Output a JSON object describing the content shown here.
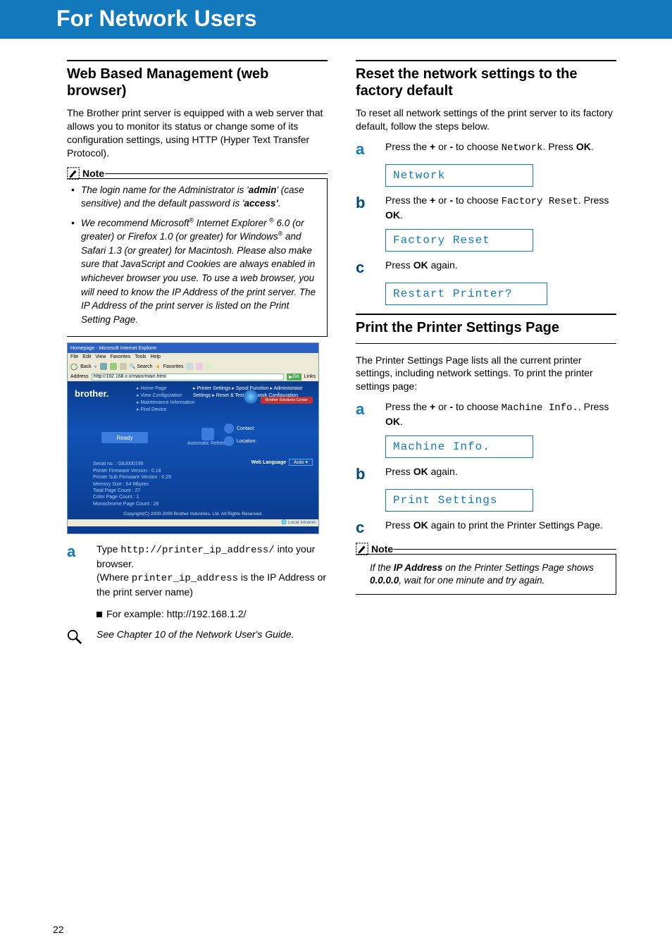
{
  "header": "For Network Users",
  "page_number": "22",
  "left": {
    "heading": "Web Based Management (web browser)",
    "intro": "The Brother print server is equipped with a web server that allows you to monitor its status or change some of its configuration settings, using HTTP (Hyper Text Transfer Protocol).",
    "note_label": "Note",
    "note_bullets": {
      "b1_pre": "The login name for the Administrator is '",
      "b1_admin": "admin",
      "b1_mid": "' (case sensitive) and the default password is '",
      "b1_access": "access'",
      "b1_end": ".",
      "b2_pre": "We recommend Microsoft",
      "b2_r1": "®",
      "b2_ie": " Internet Explorer ",
      "b2_r2": "®",
      "b2_mid1": " 6.0 (or greater) or Firefox 1.0 (or greater) for Windows",
      "b2_r3": "®",
      "b2_mid2": " and Safari 1.3 (or greater) for Macintosh. Please also make sure that JavaScript and Cookies are always enabled in whichever browser you use. To use a web browser, you will need to know the IP Address of the print server. The IP Address of the print server is listed on the Print Setting Page."
    },
    "screenshot": {
      "title": "Homepage - Microsoft Internet Explorer",
      "menu": [
        "File",
        "Edit",
        "View",
        "Favorites",
        "Tools",
        "Help"
      ],
      "back": "Back",
      "search": "Search",
      "favorites": "Favorites",
      "addr_label": "Address",
      "addr": "http://192.168.x.x/main/main.html",
      "go": "Go",
      "links": "Links",
      "brand": "brother.",
      "col1": [
        "Home Page",
        "View Configuration",
        "Maintenance Information",
        "Find Device"
      ],
      "col2": [
        "Printer Settings",
        "Spool Function",
        "Administrator Settings",
        "Reset & Test",
        "Network Configuration"
      ],
      "solutions_btn": "Brother Solutions Center",
      "ready": "Ready",
      "auto": "Automatic Refresh",
      "contact": "Contact:",
      "location": "Location:",
      "weblang_label": "Web Language",
      "weblang_val": "Auto",
      "stats": [
        "Serial no. : G8J000195",
        "Printer Firmware Version : 0.18",
        "Printer Sub Firmware Version : 0.29",
        "Memory Size : 64 Mbytes",
        "Total Page Count : 27",
        "Color Page Count : 1",
        "Monochrome Page Count : 26"
      ],
      "copyright": "Copyright(C) 2000-2009 Brother Industries, Ltd. All Rights Reserved.",
      "status": "Local intranet"
    },
    "step_a": {
      "letter": "a",
      "t1": "Type ",
      "url": "http://printer_ip_address/",
      "t2": " into your browser.",
      "t3": " (Where ",
      "mono2": "printer_ip_address",
      "t4": " is the IP Address or the print server name)",
      "ex": "For example: http://192.168.1.2/"
    },
    "see_ref": "See Chapter 10 of the Network User's Guide."
  },
  "right": {
    "sec1_heading": "Reset the network settings to the factory default",
    "sec1_intro": "To reset all network settings of the print server to its factory default, follow the steps below.",
    "s1a_letter": "a",
    "s1a_t1": "Press the ",
    "s1a_plus": "+",
    "s1a_or": " or ",
    "s1a_minus": "-",
    "s1a_t2": " to choose ",
    "s1a_mono": "Network",
    "s1a_t3": ". Press ",
    "s1a_ok": "OK",
    "s1a_t4": ".",
    "lcd1": "Network",
    "s1b_letter": "b",
    "s1b_t1": "Press the ",
    "s1b_t2": " to choose ",
    "s1b_mono": "Factory Reset",
    "s1b_t3": ". Press ",
    "lcd2": "Factory Reset",
    "s1c_letter": "c",
    "s1c_t1": "Press ",
    "s1c_t2": " again.",
    "lcd3": "Restart Printer?",
    "sec2_heading": "Print the Printer Settings Page",
    "sec2_intro": "The Printer Settings Page lists all the current printer settings, including network settings. To print the printer settings page:",
    "s2a_letter": "a",
    "s2a_mono": "Machine Info.",
    "s2a_t3": ". Press ",
    "lcd4": "Machine Info.",
    "s2b_letter": "b",
    "s2b_t1": "Press ",
    "s2b_t2": " again.",
    "lcd5": "Print Settings",
    "s2c_letter": "c",
    "s2c_t1": "Press ",
    "s2c_t2": " again to print the Printer Settings Page.",
    "note2_label": "Note",
    "note2_t1": "If the ",
    "note2_ip": "IP Address",
    "note2_t2": " on the Printer Settings Page shows ",
    "note2_zeros": "0.0.0.0",
    "note2_t3": ", wait for one minute and try again."
  }
}
